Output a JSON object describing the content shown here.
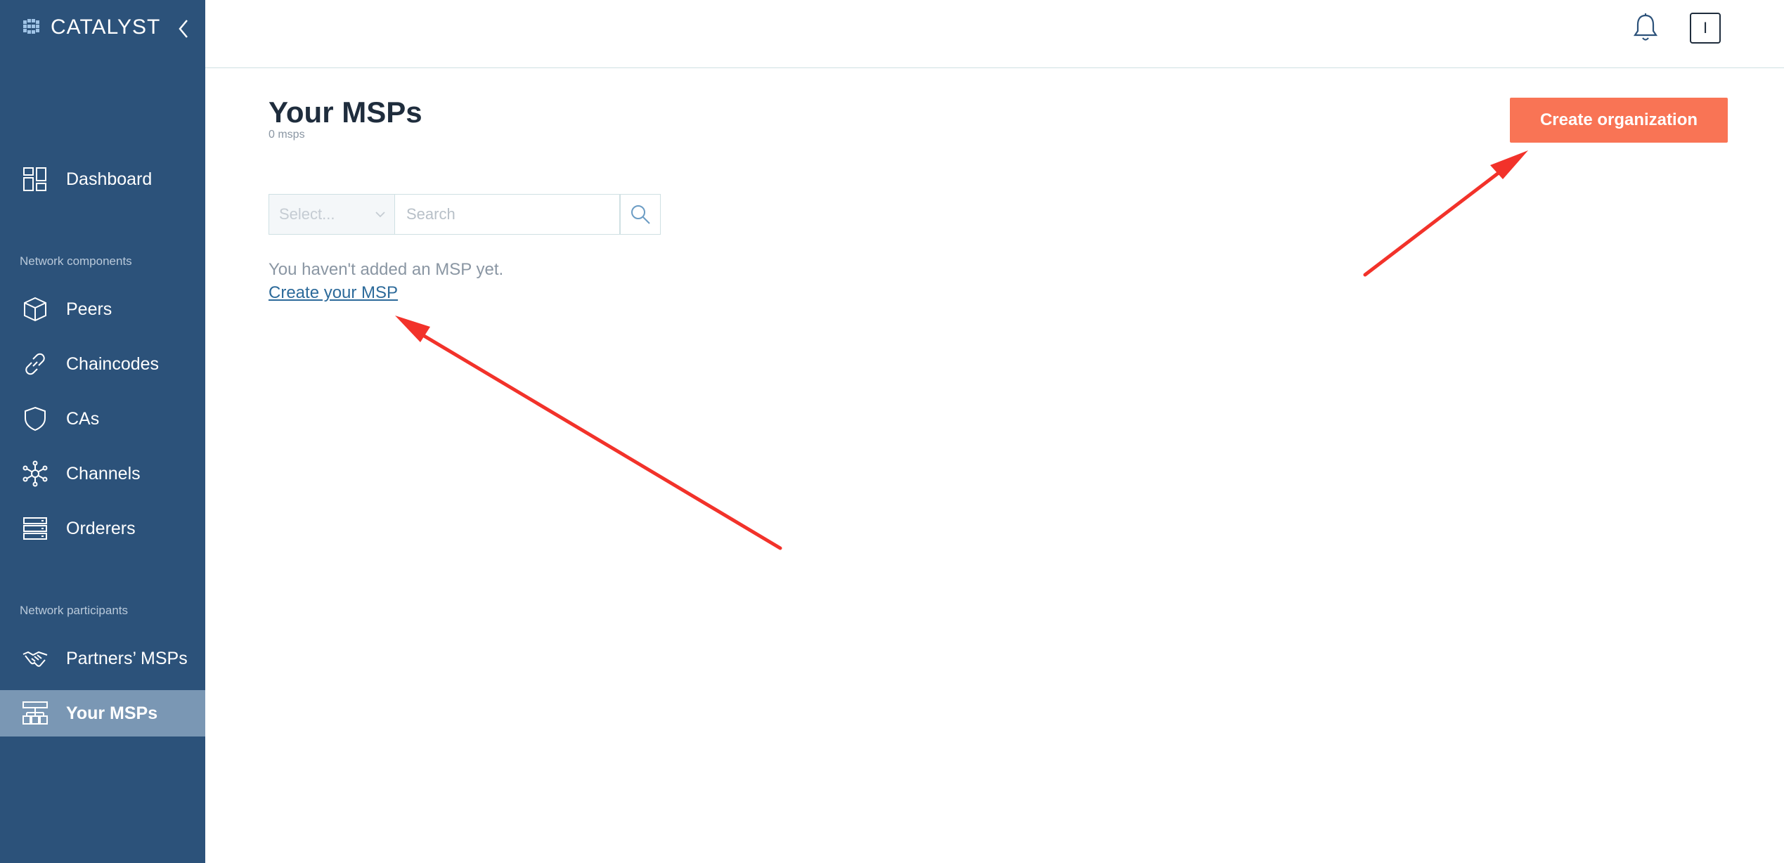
{
  "app": {
    "logo_text": "CATALYST",
    "logo_icon": "catalyst-logo-icon",
    "collapse_icon": "chevron-left-icon"
  },
  "sidebar": {
    "items_top": [
      {
        "label": "Dashboard",
        "icon": "dashboard-icon"
      }
    ],
    "section_components": "Network components",
    "components": [
      {
        "label": "Peers",
        "icon": "cube-icon"
      },
      {
        "label": "Chaincodes",
        "icon": "link-icon"
      },
      {
        "label": "CAs",
        "icon": "shield-icon"
      },
      {
        "label": "Channels",
        "icon": "network-icon"
      },
      {
        "label": "Orderers",
        "icon": "server-icon"
      }
    ],
    "section_participants": "Network participants",
    "participants": [
      {
        "label": "Partners’ MSPs",
        "icon": "handshake-icon"
      },
      {
        "label": "Your MSPs",
        "icon": "org-chart-icon",
        "active": true
      }
    ]
  },
  "header": {
    "bell_icon": "bell-icon",
    "avatar_initial": "I"
  },
  "main": {
    "title": "Your MSPs",
    "count": "0 msps",
    "create_button": "Create organization",
    "filter": {
      "select_placeholder": "Select...",
      "search_placeholder": "Search"
    },
    "empty_message": "You haven't added an MSP yet.",
    "create_link": "Create your MSP"
  },
  "colors": {
    "sidebar_bg": "#2c527a",
    "sidebar_active": "#7a97b4",
    "accent_button": "#f97455",
    "annotation_arrow": "#f2322a",
    "link": "#2c6a9a"
  }
}
